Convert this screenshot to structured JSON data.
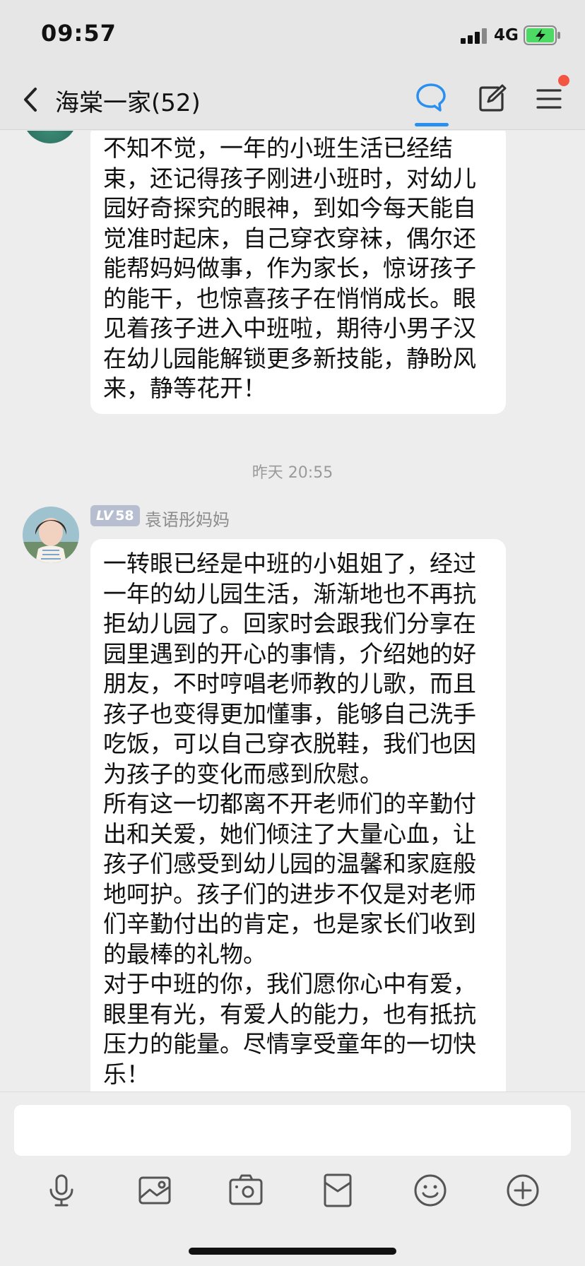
{
  "status_bar": {
    "time": "09:57",
    "network": "4G"
  },
  "nav": {
    "title": "海棠一家(52)"
  },
  "messages": [
    {
      "text": "不知不觉，一年的小班生活已经结束，还记得孩子刚进小班时，对幼儿园好奇探究的眼神，到如今每天能自觉准时起床，自己穿衣穿袜，偶尔还能帮妈妈做事，作为家长，惊讶孩子的能干，也惊喜孩子在悄悄成长。眼见着孩子进入中班啦，期待小男子汉在幼儿园能解锁更多新技能，静盼风来，静等花开！"
    },
    {
      "timestamp": "昨天 20:55",
      "level_prefix": "LV",
      "level": "58",
      "sender": "袁语彤妈妈",
      "text": "一转眼已经是中班的小姐姐了，经过一年的幼儿园生活，渐渐地也不再抗拒幼儿园了。回家时会跟我们分享在园里遇到的开心的事情，介绍她的好朋友，不时哼唱老师教的儿歌，而且孩子也变得更加懂事，能够自己洗手吃饭，可以自己穿衣脱鞋，我们也因为孩子的变化而感到欣慰。\n所有这一切都离不开老师们的辛勤付出和关爱，她们倾注了大量心血，让孩子们感受到幼儿园的温馨和家庭般地呵护。孩子们的进步不仅是对老师们辛勤付出的肯定，也是家长们收到的最棒的礼物。\n对于中班的你，我们愿你心中有爱，眼里有光，有爱人的能力，也有抵抗压力的能量。尽情享受童年的一切快乐！"
    }
  ],
  "input": {
    "value": ""
  },
  "toolbar": {
    "icons": [
      "microphone-icon",
      "image-icon",
      "camera-icon",
      "red-packet-icon",
      "emoji-icon",
      "plus-icon"
    ]
  },
  "colors": {
    "accent": "#2a90f0",
    "badge": "#b7bed0",
    "notification": "#f25643"
  }
}
